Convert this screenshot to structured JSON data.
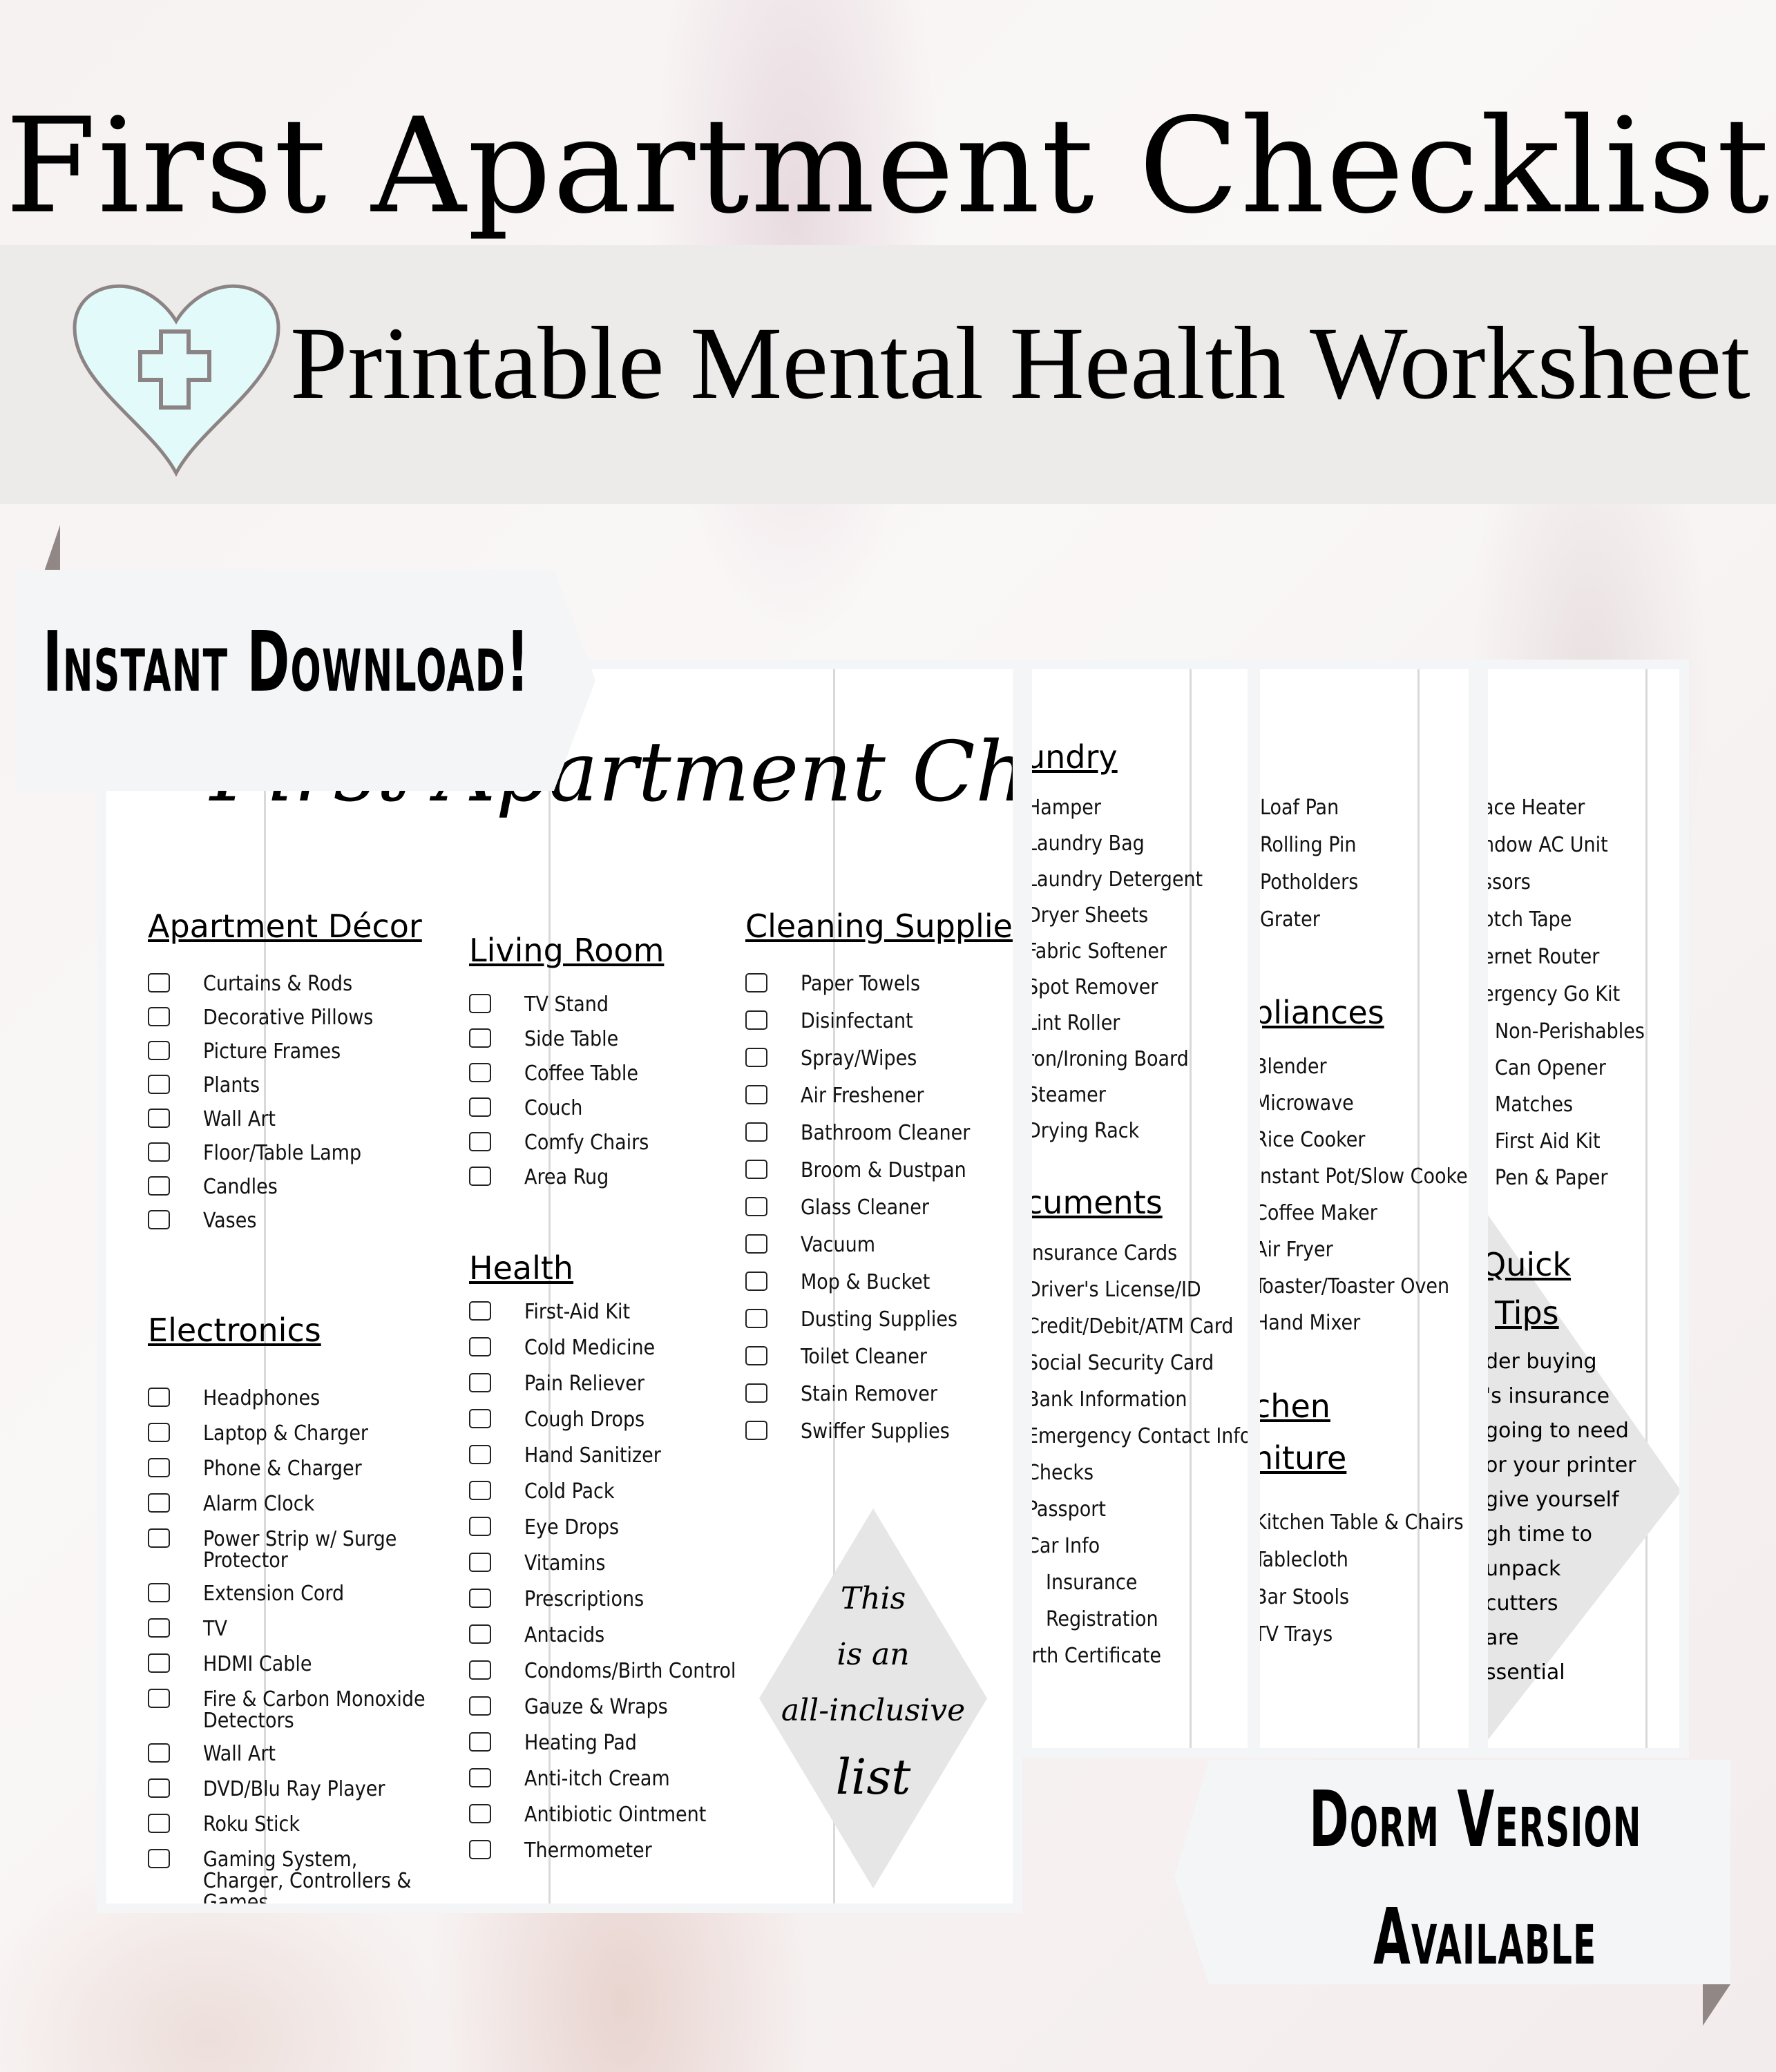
{
  "header": {
    "title": "First Apartment Checklist",
    "subtitle": "Printable Mental Health Worksheet",
    "heart_icon_color": "#e2fafa"
  },
  "badges": {
    "instant_download": "Instant Download!",
    "dorm_line1": "Dorm Version",
    "dorm_line2": "Available"
  },
  "sheet1": {
    "script_title": "First Apartment Checklist",
    "sections": [
      {
        "title": "Apartment Décor",
        "items": [
          "Curtains & Rods",
          "Decorative Pillows",
          "Picture Frames",
          "Plants",
          "Wall Art",
          "Floor/Table Lamp",
          "Candles",
          "Vases"
        ]
      },
      {
        "title": "Electronics",
        "items": [
          "Headphones",
          "Laptop & Charger",
          "Phone & Charger",
          "Alarm Clock",
          "Power Strip w/ Surge Protector",
          "Extension Cord",
          "TV",
          "HDMI Cable",
          "Fire & Carbon Monoxide Detectors",
          "Wall Art",
          "DVD/Blu Ray Player",
          "Roku Stick",
          "Gaming System, Charger, Controllers & Games"
        ]
      },
      {
        "title": "Living Room",
        "items": [
          "TV Stand",
          "Side Table",
          "Coffee Table",
          "Couch",
          "Comfy Chairs",
          "Area Rug"
        ]
      },
      {
        "title": "Health",
        "items": [
          "First-Aid Kit",
          "Cold Medicine",
          "Pain Reliever",
          "Cough Drops",
          "Hand Sanitizer",
          "Cold Pack",
          "Eye Drops",
          "Vitamins",
          "Prescriptions",
          "Antacids",
          "Condoms/Birth Control",
          "Gauze & Wraps",
          "Heating Pad",
          "Anti-itch Cream",
          "Antibiotic Ointment",
          "Thermometer"
        ]
      },
      {
        "title": "Cleaning Supplie",
        "items": [
          "Paper Towels",
          "Disinfectant",
          "Spray/Wipes",
          "Air Freshener",
          "Bathroom Cleaner",
          "Broom & Dustpan",
          "Glass Cleaner",
          "Vacuum",
          "Mop & Bucket",
          "Dusting Supplies",
          "Toilet Cleaner",
          "Stain Remover",
          "Swiffer Supplies"
        ]
      }
    ],
    "diamond_note": [
      "This",
      "is an",
      "all-inclusive",
      "list"
    ]
  },
  "sheet2": {
    "sections": [
      {
        "title": "undry",
        "items": [
          "Hamper",
          "Laundry Bag",
          "Laundry Detergent",
          "Dryer Sheets",
          "Fabric Softener",
          "Spot Remover",
          "Lint Roller",
          "ron/Ironing Board",
          "Steamer",
          "Drying Rack"
        ]
      },
      {
        "title": "cuments",
        "items": [
          "Insurance Cards",
          "Driver's License/ID",
          "Credit/Debit/ATM Card",
          "Social Security Card",
          "Bank Information",
          "Emergency Contact Info",
          "Checks",
          "Passport",
          "Car Info",
          "Insurance",
          "Registration",
          "irth Certificate"
        ]
      }
    ]
  },
  "sheet3": {
    "top_items": [
      "Loaf Pan",
      "Rolling Pin",
      "Potholders",
      "Grater"
    ],
    "sections": [
      {
        "title": "pliances",
        "items": [
          "Blender",
          "Microwave",
          "Rice Cooker",
          "Instant Pot/Slow Cooker",
          "Coffee Maker",
          "Air Fryer",
          "Toaster/Toaster Oven",
          "Hand Mixer"
        ]
      },
      {
        "title_lines": [
          "chen",
          "niture"
        ],
        "items": [
          "Kitchen Table & Chairs",
          "Tablecloth",
          "Bar Stools",
          "TV Trays"
        ]
      }
    ]
  },
  "sheet4": {
    "items": [
      "ace Heater",
      "ndow AC Unit",
      "ssors",
      "otch Tape",
      "ernet Router",
      "ergency Go Kit"
    ],
    "sub_items": [
      "Non-Perishables",
      "Can Opener",
      "Matches",
      "First Aid Kit",
      "Pen & Paper"
    ],
    "tips_title": [
      "Quick",
      "Tips"
    ],
    "tips_lines": [
      "der buying",
      "'s insurance",
      "going to need",
      "or your printer",
      "give yourself",
      "gh time to",
      "unpack",
      "cutters",
      "are",
      "ssential"
    ]
  }
}
